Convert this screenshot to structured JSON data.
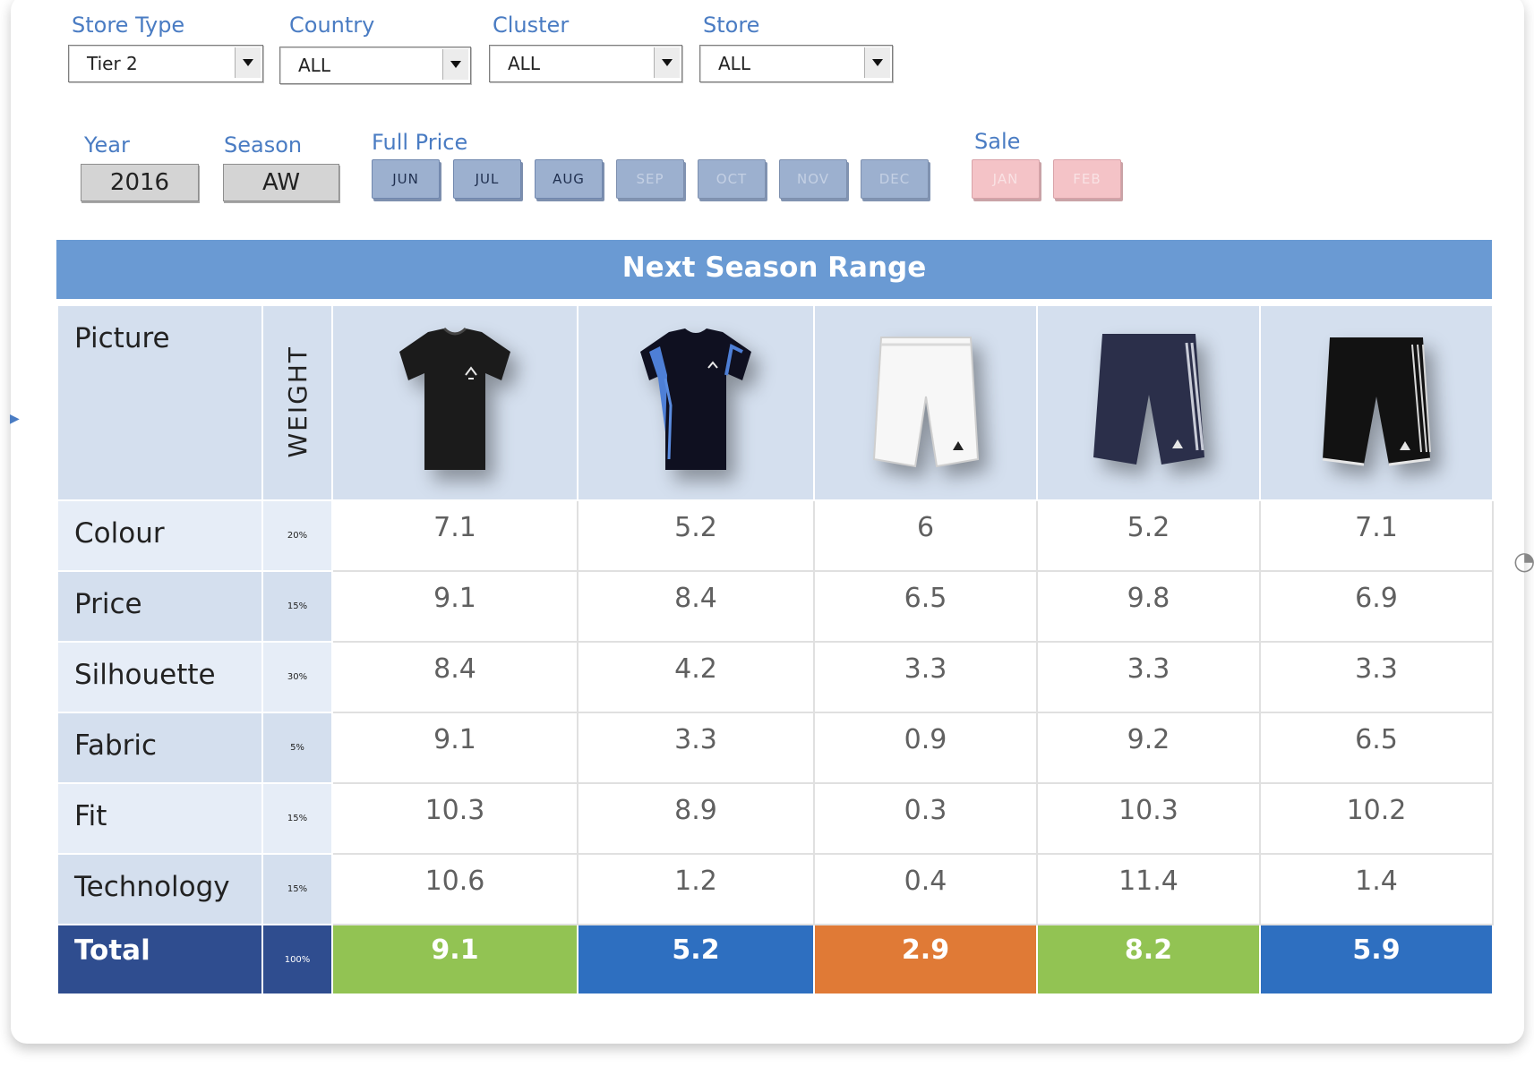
{
  "filters": {
    "store_type": {
      "label": "Store Type",
      "value": "Tier 2"
    },
    "country": {
      "label": "Country",
      "value": "ALL"
    },
    "cluster": {
      "label": "Cluster",
      "value": "ALL"
    },
    "store": {
      "label": "Store",
      "value": "ALL"
    }
  },
  "period": {
    "year_label": "Year",
    "year_value": "2016",
    "season_label": "Season",
    "season_value": "AW",
    "full_price_label": "Full Price",
    "sale_label": "Sale",
    "full_price_months": [
      "JUN",
      "JUL",
      "AUG",
      "SEP",
      "OCT",
      "NOV",
      "DEC"
    ],
    "sale_months": [
      "JAN",
      "FEB"
    ]
  },
  "range": {
    "title": "Next Season Range",
    "picture_label": "Picture",
    "weight_header": "WEIGHT",
    "products": [
      {
        "icon": "tshirt-black-icon"
      },
      {
        "icon": "tshirt-black-blue-icon"
      },
      {
        "icon": "shorts-white-icon"
      },
      {
        "icon": "shorts-navy-icon"
      },
      {
        "icon": "shorts-black-icon"
      }
    ],
    "rows": [
      {
        "label": "Colour",
        "weight": "20%",
        "values": [
          "7.1",
          "5.2",
          "6",
          "5.2",
          "7.1"
        ]
      },
      {
        "label": "Price",
        "weight": "15%",
        "values": [
          "9.1",
          "8.4",
          "6.5",
          "9.8",
          "6.9"
        ]
      },
      {
        "label": "Silhouette",
        "weight": "30%",
        "values": [
          "8.4",
          "4.2",
          "3.3",
          "3.3",
          "3.3"
        ]
      },
      {
        "label": "Fabric",
        "weight": "5%",
        "values": [
          "9.1",
          "3.3",
          "0.9",
          "9.2",
          "6.5"
        ]
      },
      {
        "label": "Fit",
        "weight": "15%",
        "values": [
          "10.3",
          "8.9",
          "0.3",
          "10.3",
          "10.2"
        ]
      },
      {
        "label": "Technology",
        "weight": "15%",
        "values": [
          "10.6",
          "1.2",
          "0.4",
          "11.4",
          "1.4"
        ]
      }
    ],
    "total": {
      "label": "Total",
      "weight": "100%",
      "values": [
        "9.1",
        "5.2",
        "2.9",
        "8.2",
        "5.9"
      ],
      "colors": [
        "#92c353",
        "#2e6fc0",
        "#e07a36",
        "#92c353",
        "#2e6fc0"
      ]
    }
  }
}
